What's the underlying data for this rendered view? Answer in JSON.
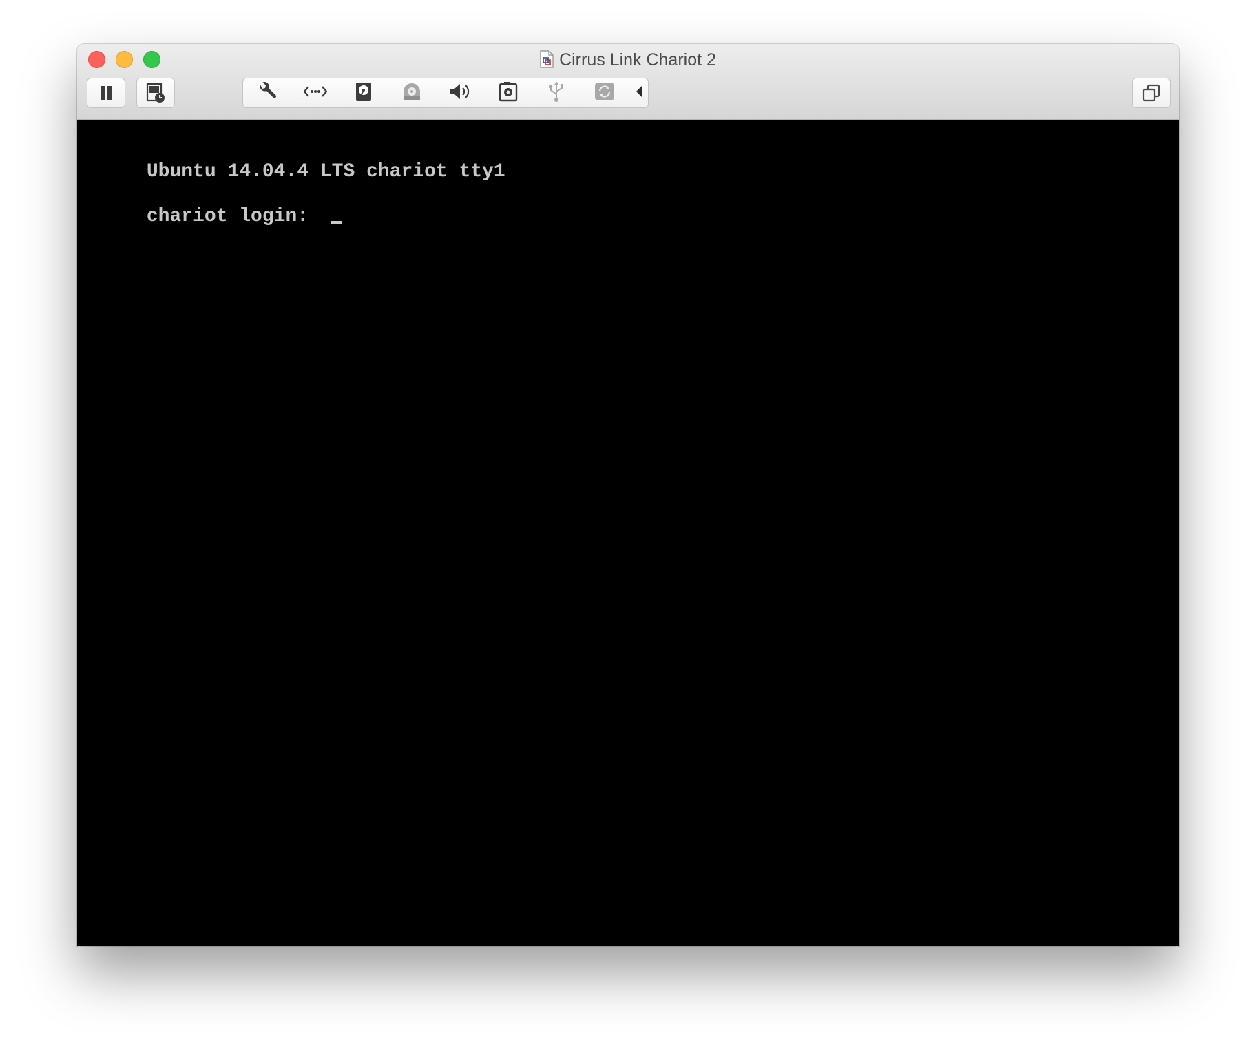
{
  "window": {
    "title": "Cirrus Link Chariot 2"
  },
  "toolbar": {
    "left_buttons": [
      {
        "name": "pause-button",
        "icon": "pause-icon"
      },
      {
        "name": "snapshot-button",
        "icon": "snapshot-icon"
      }
    ],
    "device_buttons": [
      {
        "name": "settings-button",
        "icon": "wrench-icon"
      },
      {
        "name": "network-button",
        "icon": "network-icon"
      },
      {
        "name": "hard-disk-button",
        "icon": "hard-disk-icon"
      },
      {
        "name": "cd-dvd-button",
        "icon": "cd-dvd-icon"
      },
      {
        "name": "sound-button",
        "icon": "speaker-icon"
      },
      {
        "name": "camera-button",
        "icon": "camera-icon"
      },
      {
        "name": "usb-button",
        "icon": "usb-icon"
      },
      {
        "name": "shared-folders-button",
        "icon": "sync-icon"
      },
      {
        "name": "collapse-button",
        "icon": "chevron-left-icon"
      }
    ],
    "right_buttons": [
      {
        "name": "unity-view-button",
        "icon": "windows-icon"
      }
    ]
  },
  "console": {
    "line1": "Ubuntu 14.04.4 LTS chariot tty1",
    "line2": "chariot login: "
  },
  "colors": {
    "close": "#fc605b",
    "minimize": "#fdbc40",
    "zoom": "#34c84a",
    "console_bg": "#000000",
    "console_fg": "#c8c8c8"
  }
}
